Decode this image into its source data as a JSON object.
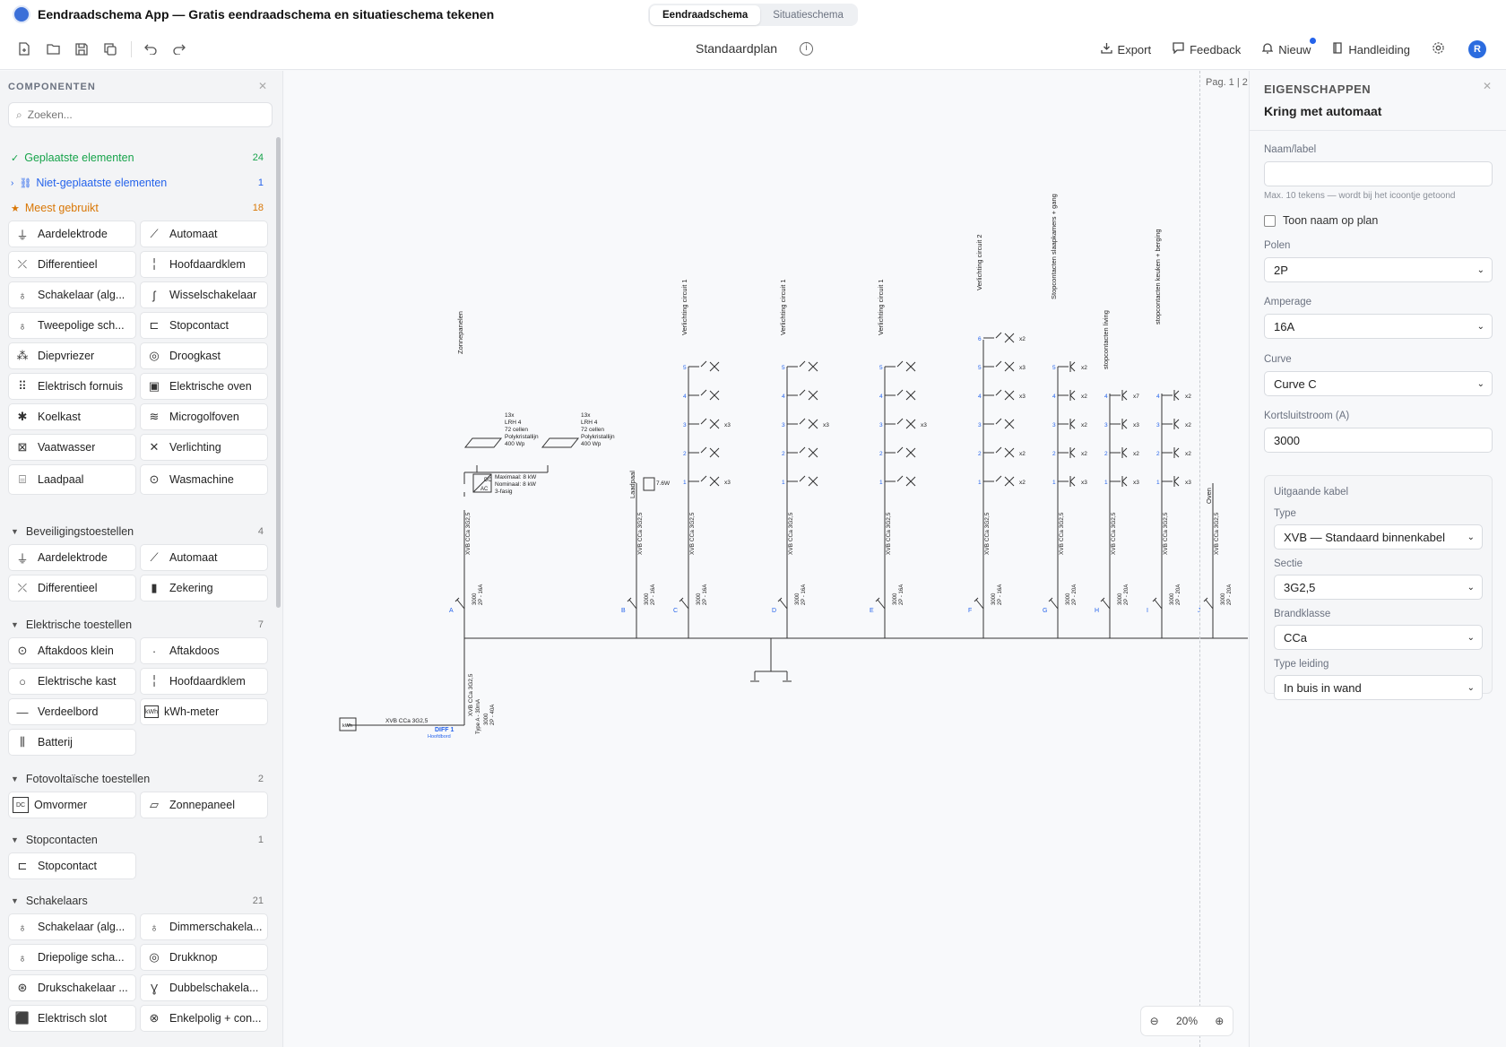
{
  "app": {
    "title": "Eendraadschema App — Gratis eendraadschema en situatieschema tekenen"
  },
  "modes": [
    {
      "label": "Eendraadschema",
      "active": true
    },
    {
      "label": "Situatieschema",
      "active": false
    }
  ],
  "toolbar": {
    "plan_title": "Standaardplan",
    "export": "Export",
    "feedback": "Feedback",
    "nieuw": "Nieuw",
    "handleiding": "Handleiding",
    "avatar": "R"
  },
  "sidebar": {
    "heading": "COMPONENTEN",
    "search_placeholder": "Zoeken...",
    "placed": {
      "label": "Geplaatste elementen",
      "count": "24"
    },
    "unplaced": {
      "label": "Niet-geplaatste elementen",
      "count": "1"
    },
    "most_used": {
      "label": "Meest gebruikt",
      "count": "18"
    },
    "most_used_items": [
      "Aardelektrode",
      "Automaat",
      "Differentieel",
      "Hoofdaardklem",
      "Schakelaar (alg...",
      "Wisselschakelaar",
      "Tweepolige sch...",
      "Stopcontact",
      "Diepvriezer",
      "Droogkast",
      "Elektrisch fornuis",
      "Elektrische oven",
      "Koelkast",
      "Microgolfoven",
      "Vaatwasser",
      "Verlichting",
      "Laadpaal",
      "Wasmachine"
    ],
    "sections": [
      {
        "label": "Beveiligingstoestellen",
        "count": "4",
        "items": [
          "Aardelektrode",
          "Automaat",
          "Differentieel",
          "Zekering"
        ]
      },
      {
        "label": "Elektrische toestellen",
        "count": "7",
        "items": [
          "Aftakdoos klein",
          "Aftakdoos",
          "Elektrische kast",
          "Hoofdaardklem",
          "Verdeelbord",
          "kWh-meter",
          "Batterij"
        ]
      },
      {
        "label": "Fotovoltaïsche toestellen",
        "count": "2",
        "items": [
          "Omvormer",
          "Zonnepaneel"
        ]
      },
      {
        "label": "Stopcontacten",
        "count": "1",
        "items": [
          "Stopcontact"
        ]
      },
      {
        "label": "Schakelaars",
        "count": "21",
        "items": [
          "Schakelaar (alg...",
          "Dimmerschakela...",
          "Driepolige scha...",
          "Drukknop",
          "Drukschakelaar ...",
          "Dubbelschakela...",
          "Elektrisch slot",
          "Enkelpolig + con..."
        ]
      }
    ]
  },
  "canvas": {
    "page_label": "Pag. 1 | 2",
    "zoom": "20%",
    "circuit_labels": [
      "Zonnepanelen",
      "Laadpaal",
      "Verlichting circuit 1",
      "Verlichting circuit 1",
      "Verlichting circuit 1",
      "Verlichting circuit 2",
      "Stopcontacten slaapkamers + gang",
      "stopcontacten living",
      "stopcontacten keuken + berging",
      "Oven"
    ],
    "breaker_letters": [
      "A",
      "B",
      "C",
      "D",
      "E",
      "F",
      "G",
      "H",
      "I",
      "J"
    ],
    "cable_label": "XVB CCa 3G2,5",
    "breaker_small": "2P - 16A",
    "breaker_small_20": "2P - 20A",
    "short_circuit": "3000",
    "main_cable": "XVB CCa 3G2,5",
    "diff_label": "DIFF 1",
    "diff_sub": "Hoofdbord",
    "diff_spec": "Type A - 30mA",
    "diff_rating": "2P - 40A",
    "kwh": "kWh",
    "pv_1": [
      "13x",
      "LRH 4",
      "72 cellen",
      "Polykristallijn",
      "400 Wp"
    ],
    "pv_2": [
      "13x",
      "LRH 4",
      "72 cellen",
      "Polykristallijn",
      "400 Wp"
    ],
    "inverter": [
      "Maximaal: 8 kW",
      "Nominaal: 8 kW",
      "3-fasig"
    ],
    "laadpaal_kw": "7.6W",
    "dc": "DC",
    "ac": "AC",
    "x3": "x3",
    "x2": "x2",
    "x7": "x7"
  },
  "props": {
    "heading": "EIGENSCHAPPEN",
    "title": "Kring met automaat",
    "naam_label": "Naam/label",
    "naam_value": "",
    "hint": "Max. 10 tekens — wordt bij het icoontje getoond",
    "toon_naam": "Toon naam op plan",
    "polen_label": "Polen",
    "polen_value": "2P",
    "amperage_label": "Amperage",
    "amperage_value": "16A",
    "curve_label": "Curve",
    "curve_value": "Curve C",
    "kort_label": "Kortsluitstroom (A)",
    "kort_value": "3000",
    "cable_heading": "Uitgaande kabel",
    "type_label": "Type",
    "type_value": "XVB — Standaard binnenkabel",
    "sectie_label": "Sectie",
    "sectie_value": "3G2,5",
    "brand_label": "Brandklasse",
    "brand_value": "CCa",
    "leiding_label": "Type leiding",
    "leiding_value": "In buis in wand"
  }
}
